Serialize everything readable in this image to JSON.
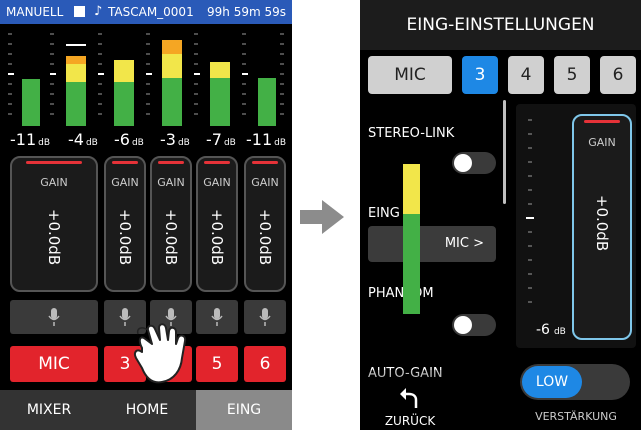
{
  "status": {
    "mode": "MANUELL",
    "file": "TASCAM_0001",
    "remaining": "99h 59m 59s"
  },
  "left": {
    "channels": [
      {
        "level_db": "-11",
        "unit": "dB",
        "gain_label": "GAIN",
        "gain": "+0.0dB"
      },
      {
        "level_db": "-4",
        "unit": "dB",
        "gain_label": "GAIN",
        "gain": "+0.0dB"
      },
      {
        "level_db": "-6",
        "unit": "dB",
        "gain_label": "GAIN",
        "gain": "+0.0dB"
      },
      {
        "level_db": "-3",
        "unit": "dB",
        "gain_label": "GAIN",
        "gain": "+0.0dB"
      },
      {
        "level_db": "-7",
        "unit": "dB",
        "gain_label": "GAIN",
        "gain": "+0.0dB"
      },
      {
        "level_db": "-11",
        "unit": "dB",
        "gain_label": "GAIN",
        "gain": "+0.0dB"
      }
    ],
    "channel_buttons": [
      "MIC",
      "3",
      "4",
      "5",
      "6"
    ],
    "tabs": [
      "MIXER",
      "HOME",
      "EING"
    ]
  },
  "right": {
    "title": "EING-EINSTELLUNGEN",
    "input_buttons": [
      "MIC",
      "3",
      "4",
      "5",
      "6"
    ],
    "stereo_link_label": "STEREO-LINK",
    "input_label": "EING",
    "input_value": "MIC",
    "phantom_label": "PHANTOM",
    "auto_gain_label": "AUTO-GAIN",
    "back_label": "ZURÜCK",
    "gain_label": "GAIN",
    "gain_value": "+0.0dB",
    "level_db": "-6",
    "level_unit": "dB",
    "low_label": "LOW",
    "amp_label": "VERSTÄRKUNG"
  },
  "colors": {
    "accent": "#1e88e5",
    "status_bar": "#2a5ab8",
    "red": "#e2242c",
    "meter_green": "#43b046",
    "meter_yellow": "#f2e64a",
    "meter_orange": "#f5a623"
  }
}
